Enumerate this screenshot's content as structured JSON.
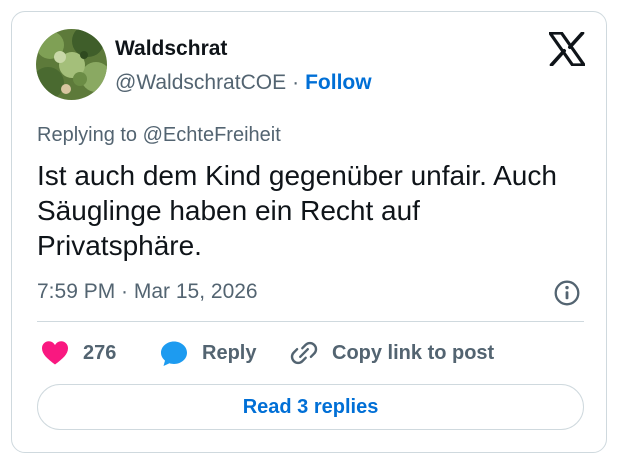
{
  "author": {
    "display_name": "Waldschrat",
    "handle": "@WaldschratCOE",
    "separator": "·",
    "follow_label": "Follow"
  },
  "reply_context": {
    "prefix": "Replying to",
    "mention": "@EchteFreiheit"
  },
  "tweet": {
    "text": "Ist auch dem Kind gegenüber unfair. Auch Säuglinge haben ein Recht auf Privatsphäre.",
    "timestamp": "7:59 PM · Mar 15, 2026"
  },
  "actions": {
    "like_count": "276",
    "reply_label": "Reply",
    "copy_link_label": "Copy link to post"
  },
  "footer": {
    "read_replies_label": "Read 3 replies"
  },
  "icons": {
    "brand": "x-logo-icon",
    "info": "info-icon",
    "like": "heart-icon",
    "reply": "speech-bubble-icon",
    "copy": "link-icon"
  },
  "colors": {
    "accent": "#006fd6",
    "like": "#f91880",
    "reply": "#1d9bf0",
    "secondary_text": "#536471",
    "border": "#cfd9de"
  }
}
